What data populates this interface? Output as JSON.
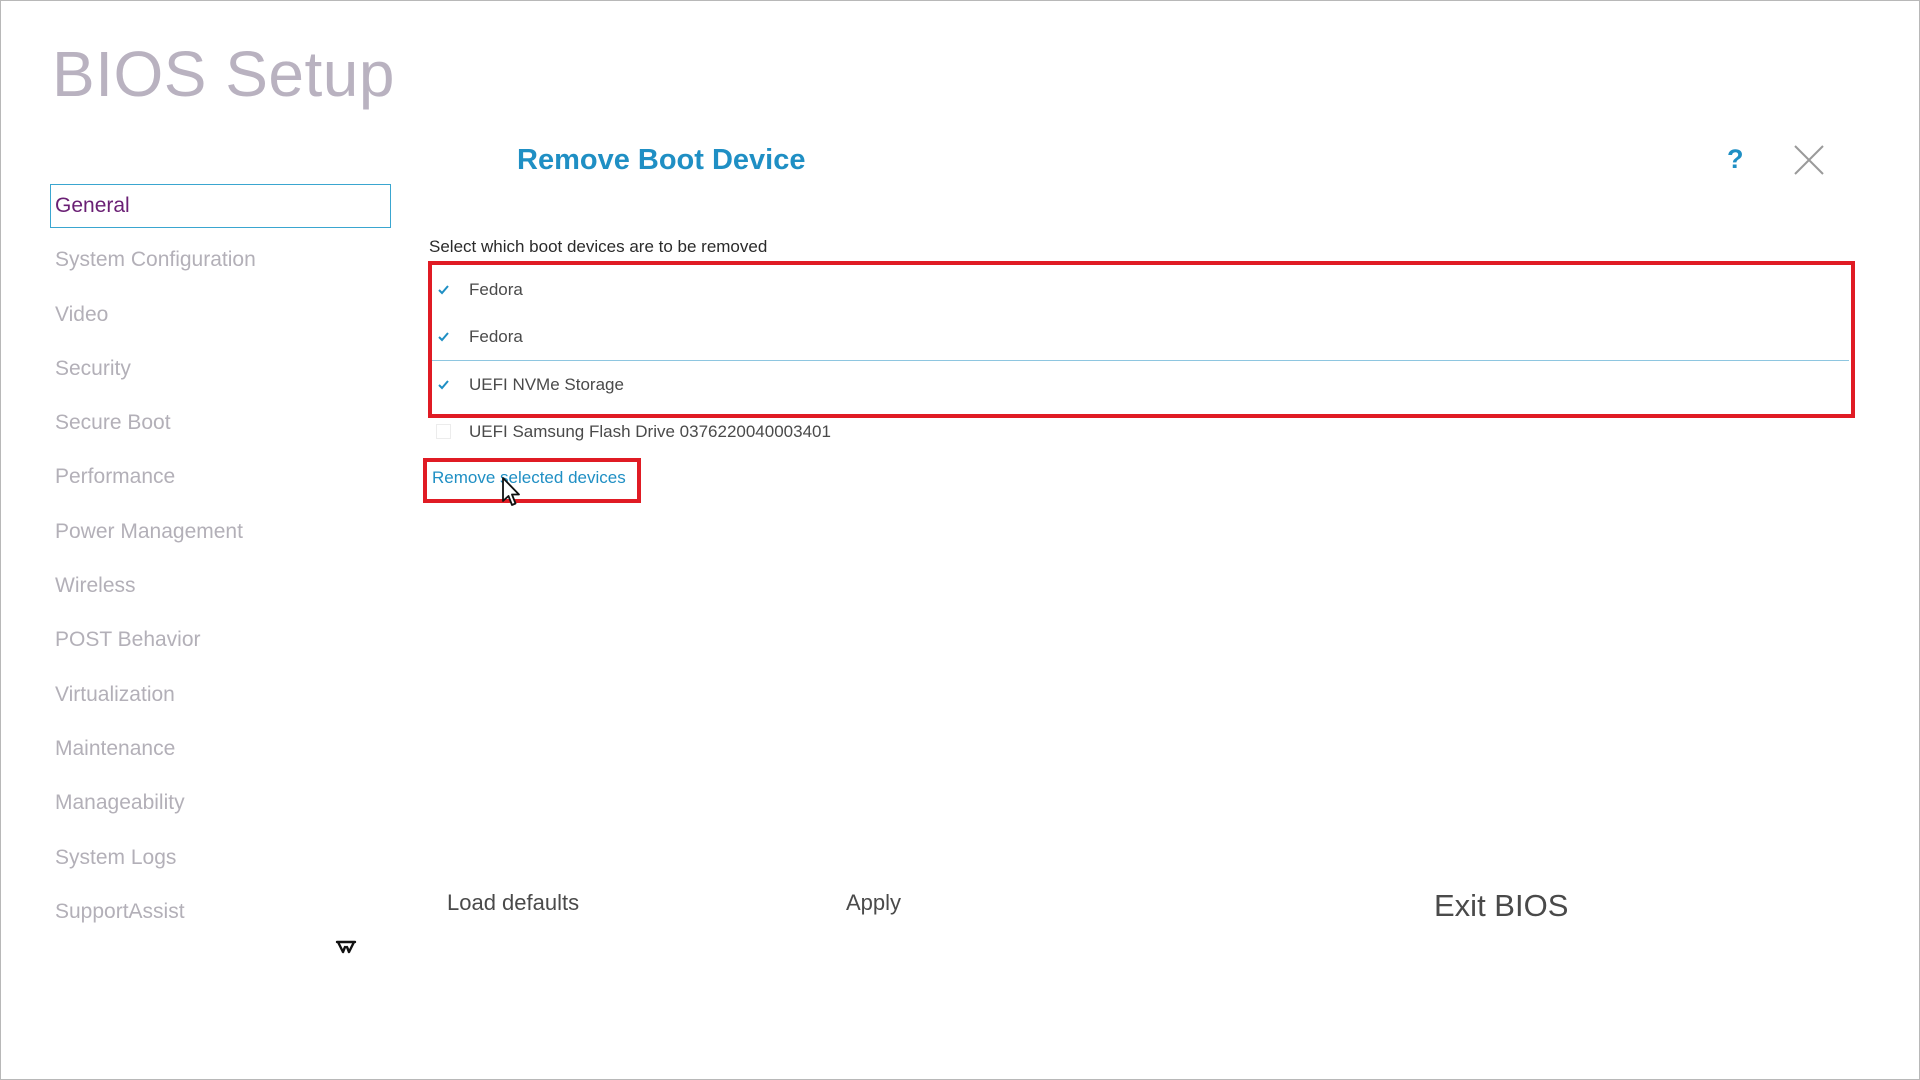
{
  "app": {
    "title": "BIOS Setup"
  },
  "sidebar": {
    "items": [
      {
        "label": "General",
        "active": true
      },
      {
        "label": "System Configuration"
      },
      {
        "label": "Video"
      },
      {
        "label": "Security"
      },
      {
        "label": "Secure Boot"
      },
      {
        "label": "Performance"
      },
      {
        "label": "Power Management"
      },
      {
        "label": "Wireless"
      },
      {
        "label": "POST Behavior"
      },
      {
        "label": "Virtualization"
      },
      {
        "label": "Maintenance"
      },
      {
        "label": "Manageability"
      },
      {
        "label": "System Logs"
      },
      {
        "label": "SupportAssist"
      }
    ],
    "collapse_icon": "collapse-arrows-icon"
  },
  "dialog": {
    "title": "Remove Boot Device",
    "help_label": "?",
    "instruction": "Select which boot devices are to be removed",
    "devices": [
      {
        "label": "Fedora",
        "checked": true
      },
      {
        "label": "Fedora",
        "checked": true
      },
      {
        "label": "UEFI NVMe Storage",
        "checked": true
      },
      {
        "label": "UEFI Samsung Flash Drive 0376220040003401",
        "checked": false
      }
    ],
    "remove_label": "Remove selected devices"
  },
  "footer": {
    "load_defaults_label": "Load defaults",
    "apply_label": "Apply",
    "exit_label": "Exit BIOS"
  },
  "colors": {
    "accent": "#1f8fc4",
    "annotation": "#e01b24",
    "active_text": "#6a1f74",
    "muted_text": "#b3b0b8"
  }
}
